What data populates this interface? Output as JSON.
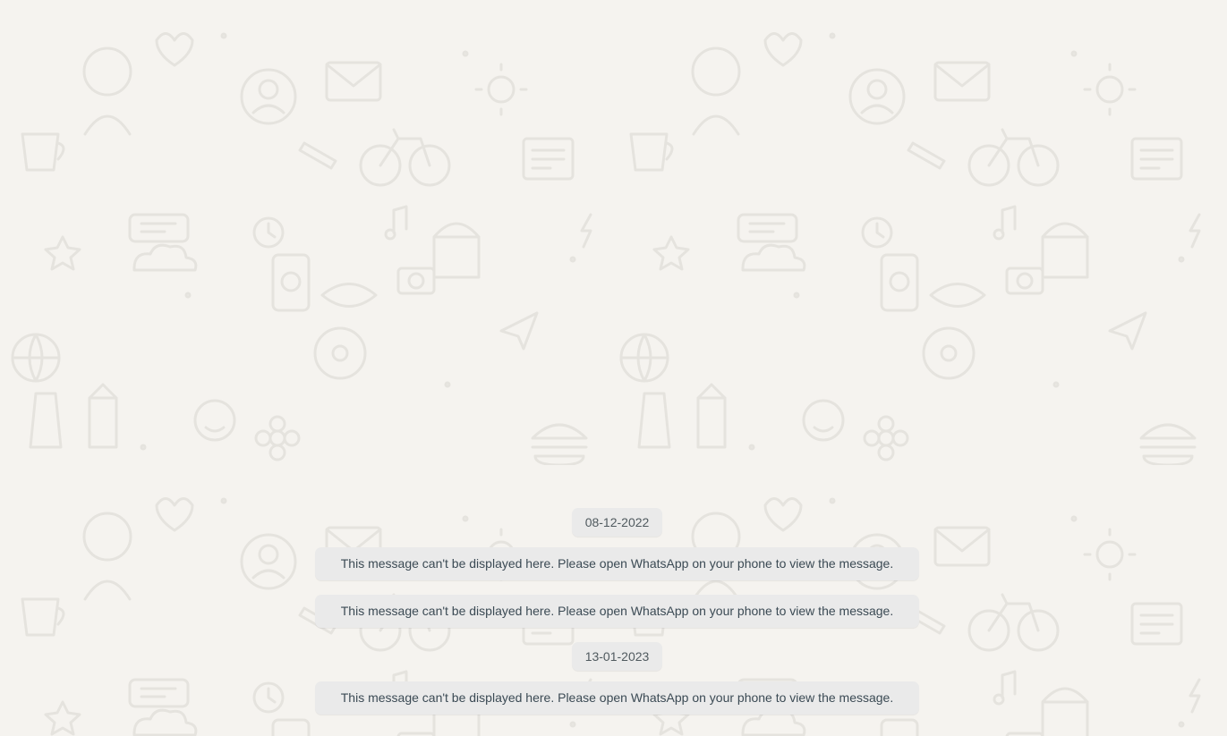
{
  "chat": {
    "background_color": "#f5f3ef",
    "doodle_color": "#e4e2dd",
    "bubble_color": "#eaeaea",
    "timeline": [
      {
        "type": "date",
        "text": "08-12-2022"
      },
      {
        "type": "system",
        "text": "This message can't be displayed here. Please open WhatsApp on your phone to view the message."
      },
      {
        "type": "system",
        "text": "This message can't be displayed here. Please open WhatsApp on your phone to view the message."
      },
      {
        "type": "date",
        "text": "13-01-2023"
      },
      {
        "type": "system",
        "text": "This message can't be displayed here. Please open WhatsApp on your phone to view the message."
      }
    ]
  }
}
